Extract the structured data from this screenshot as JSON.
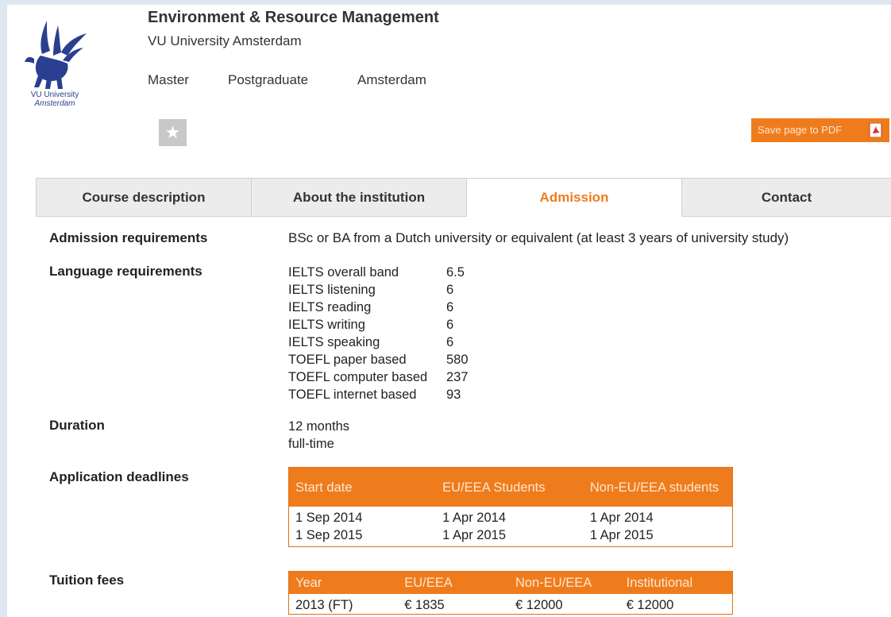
{
  "header": {
    "title": "Environment & Resource Management",
    "institution": "VU University Amsterdam",
    "degree": "Master",
    "level": "Postgraduate",
    "city": "Amsterdam",
    "logo_line1": "VU University",
    "logo_line2": "Amsterdam",
    "favorite_icon": "star-icon",
    "pdf_button_label": "Save page to PDF",
    "pdf_icon": "pdf-file-icon"
  },
  "colors": {
    "accent": "#ef7c1c",
    "tab_bg": "#ececec",
    "page_bg": "#dfe8f1",
    "logo_blue": "#2a3f8f"
  },
  "tabs": [
    {
      "label": "Course description",
      "active": false
    },
    {
      "label": "About the institution",
      "active": false
    },
    {
      "label": "Admission",
      "active": true
    },
    {
      "label": "Contact",
      "active": false
    }
  ],
  "admission": {
    "admission_requirements": {
      "label": "Admission requirements",
      "value": "BSc or BA from a Dutch university or equivalent (at least 3 years of university study)"
    },
    "language_requirements": {
      "label": "Language requirements",
      "items": [
        {
          "name": "IELTS overall band",
          "score": "6.5"
        },
        {
          "name": "IELTS listening",
          "score": "6"
        },
        {
          "name": "IELTS reading",
          "score": "6"
        },
        {
          "name": "IELTS writing",
          "score": "6"
        },
        {
          "name": "IELTS speaking",
          "score": "6"
        },
        {
          "name": "TOEFL paper based",
          "score": "580"
        },
        {
          "name": "TOEFL computer based",
          "score": "237"
        },
        {
          "name": "TOEFL internet based",
          "score": "93"
        }
      ]
    },
    "duration": {
      "label": "Duration",
      "line1": "12 months",
      "line2": "full-time"
    },
    "deadlines": {
      "label": "Application deadlines",
      "headers": [
        "Start date",
        "EU/EEA Students",
        "Non-EU/EEA students"
      ],
      "rows": [
        [
          "1 Sep 2014",
          "1 Apr 2014",
          "1 Apr 2014"
        ],
        [
          "1 Sep 2015",
          "1 Apr 2015",
          "1 Apr 2015"
        ]
      ]
    },
    "tuition": {
      "label": "Tuition fees",
      "headers": [
        "Year",
        "EU/EEA",
        "Non-EU/EEA",
        "Institutional"
      ],
      "rows": [
        [
          "2013 (FT)",
          "€ 1835",
          "€ 12000",
          "€ 12000"
        ]
      ]
    }
  }
}
